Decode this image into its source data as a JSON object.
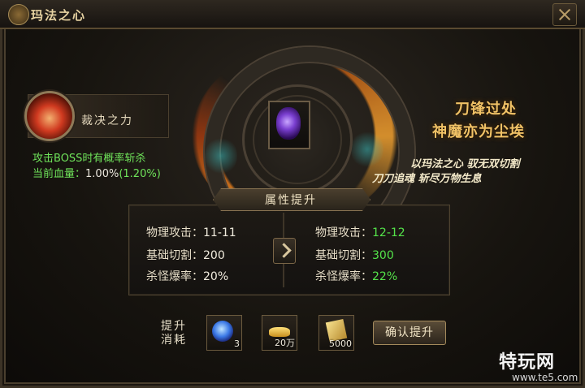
{
  "window": {
    "title": "玛法之心"
  },
  "skill": {
    "name": "裁决之力",
    "desc": "攻击BOSS时有概率斩杀",
    "hp_label": "当前血量：",
    "hp_current": "1.00%",
    "hp_next": "(1.20%)",
    "icon": "red-slash-skill-icon"
  },
  "slogan": {
    "line1": "刀锋过处",
    "line2": "神魔亦为尘埃",
    "verse1": "以玛法之心 驭无双切割",
    "verse2": "刀刀追魂 斩尽万物生息"
  },
  "attributes": {
    "header": "属性提升",
    "current": [
      {
        "label": "物理攻击：",
        "value": "11-11"
      },
      {
        "label": "基础切割：",
        "value": "200"
      },
      {
        "label": "杀怪爆率：",
        "value": "20%"
      }
    ],
    "next": [
      {
        "label": "物理攻击：",
        "value": "12-12"
      },
      {
        "label": "基础切割：",
        "value": "300"
      },
      {
        "label": "杀怪爆率：",
        "value": "22%"
      }
    ]
  },
  "cost": {
    "label_line1": "提升",
    "label_line2": "消耗",
    "items": [
      {
        "icon": "blue-soul-orb-icon",
        "count": "3"
      },
      {
        "icon": "gold-ingot-icon",
        "count": "20万"
      },
      {
        "icon": "gold-paper-icon",
        "count": "5000"
      }
    ],
    "confirm_label": "确认提升"
  },
  "watermark": {
    "logo": "特玩网",
    "url": "www.te5.com"
  },
  "colors": {
    "gold": "#f1c266",
    "green": "#54e34a",
    "frame": "#4a3f2e"
  }
}
